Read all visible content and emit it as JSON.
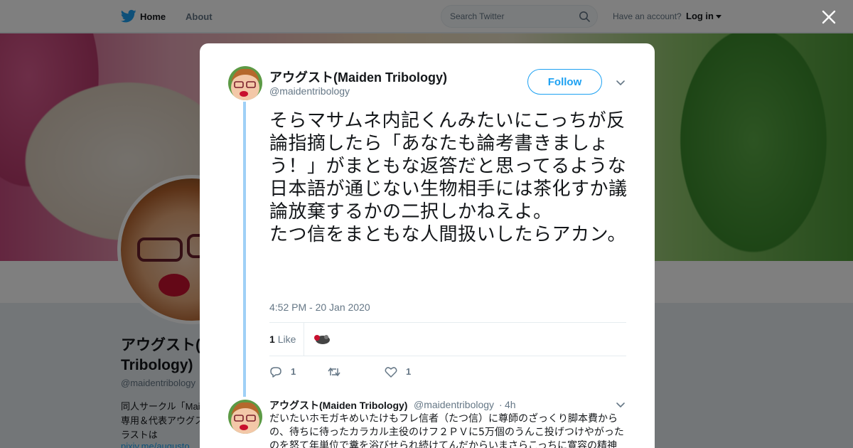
{
  "topbar": {
    "home_label": "Home",
    "about_label": "About",
    "search_placeholder": "Search Twitter",
    "account_prompt": "Have an account?",
    "login_label": "Log in"
  },
  "profile": {
    "name": "アウグスト(Maiden Tribology)",
    "handle": "@maidentribology",
    "bio": "同人サークル「Maiden Tribology」専用＆代表アウグストの漫画・イラストは",
    "link": "pixiv.me/augusto"
  },
  "tweet": {
    "author_name": "アウグスト(Maiden Tribology)",
    "author_handle": "@maidentribology",
    "follow_label": "Follow",
    "text": "そらマサムネ内記くんみたいにこっちが反論指摘したら「あなたも論考書きましょう！」がまともな返答だと思ってるような日本語が通じない生物相手には茶化すか議論放棄するかの二択しかねえよ。\nたつ信をまともな人間扱いしたらアカン。",
    "time": "4:52 PM - 20 Jan 2020",
    "likes_count": "1",
    "likes_label": "Like",
    "actions": {
      "reply_count": "1",
      "retweet_count": "",
      "like_count": "1"
    }
  },
  "reply": {
    "author_name": "アウグスト(Maiden Tribology)",
    "author_handle": "@maidentribology",
    "dot": "·",
    "time": "4h",
    "text": "だいたいホモガキめいたけもフレ信者（たつ信）に尊師のざっくり脚本費からの、待ちに待ったカラカル主役のけフ２ＰＶに5万個のうんこ投げつけやがったのを怒て年単位で糞を浴びせられ続けてんだからいまさらこっちに寛容の精神"
  },
  "colors": {
    "accent": "#1da1f2",
    "thread_line": "#9fd0f6",
    "muted": "#657786"
  },
  "icons": {
    "logo": "twitter-bird-icon",
    "search": "search-icon",
    "close": "close-icon",
    "more": "chevron-down-icon",
    "reply": "reply-icon",
    "retweet": "retweet-icon",
    "like": "heart-icon"
  }
}
